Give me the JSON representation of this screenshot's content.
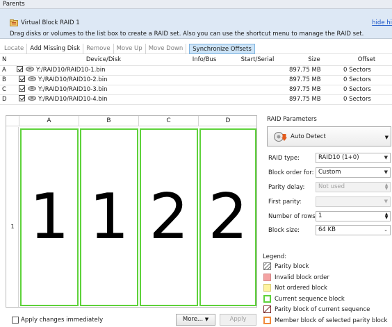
{
  "parents_header": "Parents",
  "group": {
    "title": "Virtual Block RAID 1",
    "hide_link": "hide hi",
    "description": "Drag disks or volumes to the list box to create a RAID set. Also you can use the shortcut menu to manage the RAID set."
  },
  "toolbar": {
    "locate": "Locate",
    "add_missing_disk": "Add Missing Disk",
    "remove": "Remove",
    "move_up": "Move Up",
    "move_down": "Move Down",
    "synchronize_offsets": "Synchronize Offsets"
  },
  "disk_table": {
    "headers": [
      "N",
      "Device/Disk",
      "Info/Bus",
      "Start/Serial",
      "Size",
      "Offset"
    ],
    "rows": [
      {
        "n": "A",
        "device": "Y:/RAID10/RAID10-1.bin",
        "info": "",
        "start": "",
        "size": "897.75 MB",
        "offset": "0 Sectors"
      },
      {
        "n": "B",
        "device": "Y:/RAID10/RAID10-2.bin",
        "info": "",
        "start": "",
        "size": "897.75 MB",
        "offset": "0 Sectors"
      },
      {
        "n": "C",
        "device": "Y:/RAID10/RAID10-3.bin",
        "info": "",
        "start": "",
        "size": "897.75 MB",
        "offset": "0 Sectors"
      },
      {
        "n": "D",
        "device": "Y:/RAID10/RAID10-4.bin",
        "info": "",
        "start": "",
        "size": "897.75 MB",
        "offset": "0 Sectors"
      }
    ]
  },
  "layout_grid": {
    "columns": [
      "A",
      "B",
      "C",
      "D"
    ],
    "row_label": "1",
    "blocks": [
      "1",
      "1",
      "2",
      "2"
    ],
    "block_border_color": "#5ed23a"
  },
  "bottom": {
    "apply_immediately": "Apply changes immediately",
    "more": "More...",
    "apply": "Apply"
  },
  "raid_params": {
    "title": "RAID Parameters",
    "auto_detect": "Auto Detect",
    "raid_type_label": "RAID type:",
    "raid_type_value": "RAID10 (1+0)",
    "block_order_label": "Block order for:",
    "block_order_value": "Custom",
    "parity_delay_label": "Parity delay:",
    "parity_delay_value": "Not used",
    "first_parity_label": "First parity:",
    "first_parity_value": "",
    "rows_label": "Number of rows:",
    "rows_value": "1",
    "block_size_label": "Block size:",
    "block_size_value": "64 KB"
  },
  "legend": {
    "title": "Legend:",
    "items": [
      {
        "label": "Parity block",
        "color": "#ffffff",
        "pattern": "hatch"
      },
      {
        "label": "Invalid block order",
        "color": "#f4a3a3",
        "pattern": "solid"
      },
      {
        "label": "Not ordered block",
        "color": "#fff3a0",
        "pattern": "solid"
      },
      {
        "label": "Current sequence block",
        "color": "#5ed23a",
        "pattern": "outline"
      },
      {
        "label": "Parity block of current sequence",
        "color": "#7a2a2a",
        "pattern": "hatch-outline"
      },
      {
        "label": "Member block of selected parity block",
        "color": "#f08a3c",
        "pattern": "outline"
      }
    ]
  }
}
